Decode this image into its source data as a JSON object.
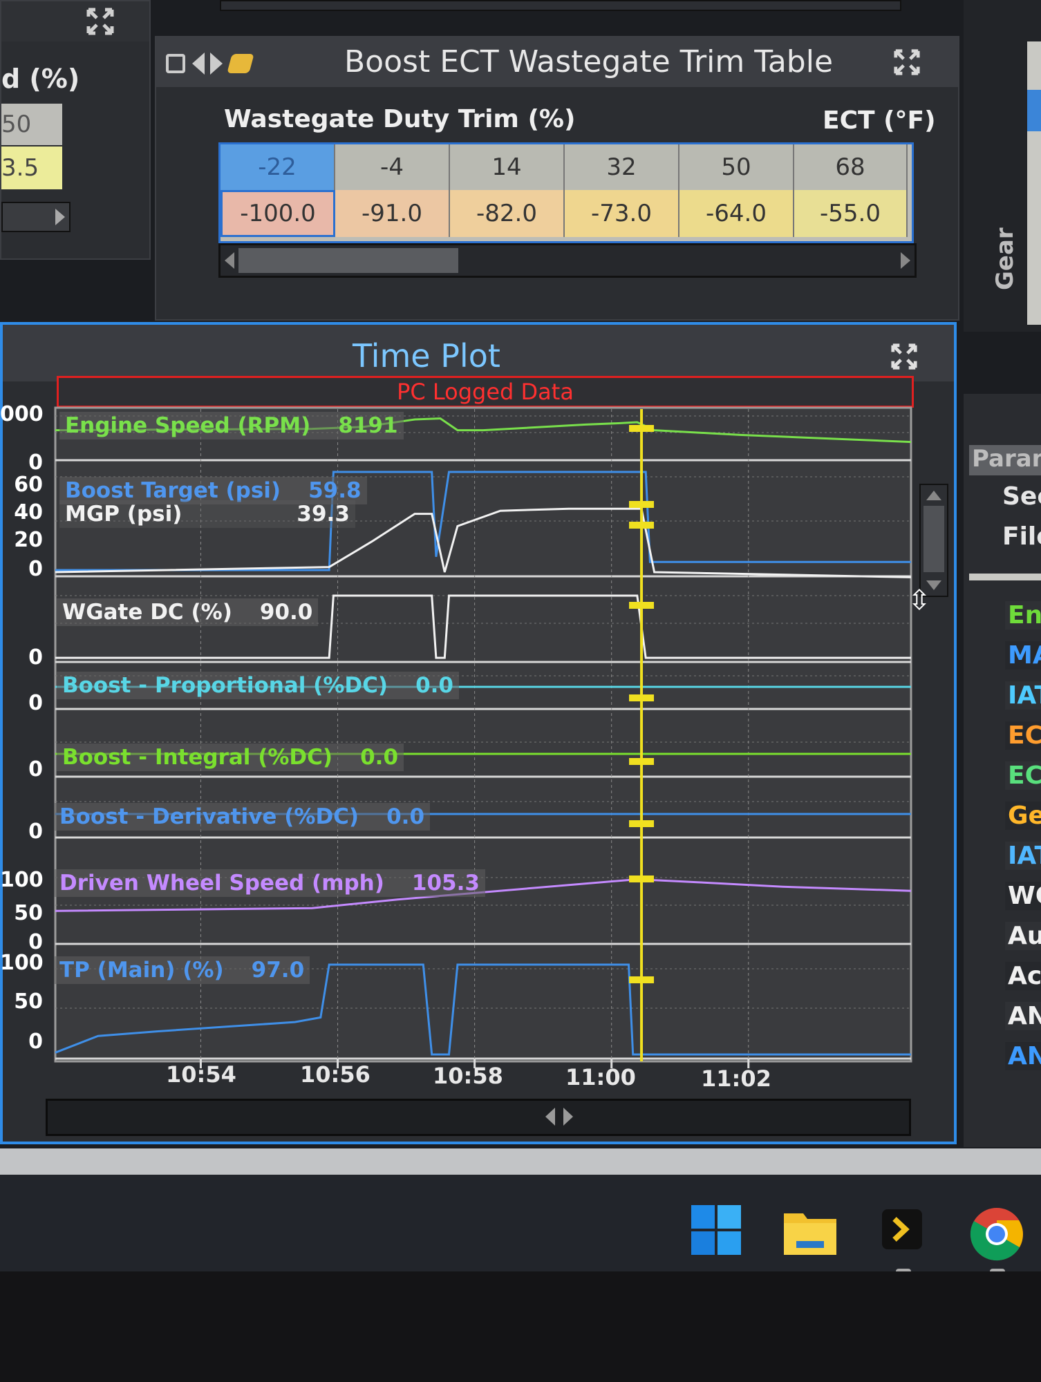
{
  "left_panel": {
    "title_partial": "d (%)",
    "values": [
      "50",
      "3.5"
    ]
  },
  "trim_table": {
    "title": "Boost ECT Wastegate Trim Table",
    "row_label": "Wastegate Duty Trim (%)",
    "col_label": "ECT (°F)",
    "ect_values": [
      "-22",
      "-4",
      "14",
      "32",
      "50",
      "68"
    ],
    "trim_values": [
      "-100.0",
      "-91.0",
      "-82.0",
      "-73.0",
      "-64.0",
      "-55.0"
    ],
    "trim_colors": [
      "#e8b8a9",
      "#ecc7a3",
      "#efcf9c",
      "#efd68f",
      "#ecdb8c",
      "#e8df95"
    ]
  },
  "right_panel": {
    "gear_label": "Gear",
    "params_header": "Param",
    "sec_label": "Sec",
    "file_label": "File",
    "items": [
      {
        "label": "Eng",
        "color": "#6fdc3a"
      },
      {
        "label": "MA",
        "color": "#3d9bff"
      },
      {
        "label": "IAT",
        "color": "#4ecbff"
      },
      {
        "label": "ECT",
        "color": "#ff9d2e"
      },
      {
        "label": "ECT",
        "color": "#59e07d"
      },
      {
        "label": "Gea",
        "color": "#ffb72a"
      },
      {
        "label": "IAT",
        "color": "#50b7ff"
      },
      {
        "label": "WG",
        "color": "#f0f0f0"
      },
      {
        "label": "Aux",
        "color": "#f0f0f0"
      },
      {
        "label": "Act",
        "color": "#f0f0f0"
      },
      {
        "label": "AN",
        "color": "#f0f0f0"
      },
      {
        "label": "AN",
        "color": "#3d9bff"
      }
    ]
  },
  "time_plot": {
    "title": "Time Plot",
    "banner": "PC Logged Data",
    "channels": [
      {
        "name": "Engine Speed (RPM)",
        "value": "8191",
        "color": "#79e04b"
      },
      {
        "name": "Boost Target (psi)",
        "value": "59.8",
        "color": "#3f8fe8"
      },
      {
        "name": "MGP (psi)",
        "value": "39.3",
        "color": "#f2f2f2"
      },
      {
        "name": "WGate DC (%)",
        "value": "90.0",
        "color": "#f2f2f2"
      },
      {
        "name": "Boost - Proportional (%DC)",
        "value": "0.0",
        "color": "#58d6e6"
      },
      {
        "name": "Boost - Integral (%DC)",
        "value": "0.0",
        "color": "#7ae02e"
      },
      {
        "name": "Boost - Derivative (%DC)",
        "value": "0.0",
        "color": "#3f8fe8"
      },
      {
        "name": "Driven Wheel Speed (mph)",
        "value": "105.3",
        "color": "#c48aff"
      },
      {
        "name": "TP (Main) (%)",
        "value": "97.0",
        "color": "#3f8fe8"
      }
    ],
    "y_ticks": [
      "000",
      "0",
      "60",
      "40",
      "20",
      "0",
      "0",
      "0",
      "0",
      "0",
      "100",
      "50",
      "0",
      "100",
      "50",
      "0"
    ],
    "x_ticks": [
      "10:54",
      "10:56",
      "10:58",
      "11:00",
      "11:02"
    ]
  },
  "chart_data": {
    "type": "line",
    "x_axis": "time",
    "x_tick_labels": [
      "10:54",
      "10:56",
      "10:58",
      "11:00",
      "11:02"
    ],
    "cursor_time": "11:00",
    "series": [
      {
        "name": "Engine Speed (RPM)",
        "points": [
          [
            0,
            0.55
          ],
          [
            0.3,
            0.58
          ],
          [
            0.36,
            0.62
          ],
          [
            0.42,
            0.78
          ],
          [
            0.45,
            0.8
          ],
          [
            0.47,
            0.55
          ],
          [
            0.5,
            0.55
          ],
          [
            0.62,
            0.67
          ],
          [
            0.66,
            0.7
          ],
          [
            0.68,
            0.72
          ],
          [
            0.7,
            0.55
          ],
          [
            0.8,
            0.45
          ],
          [
            1,
            0.3
          ]
        ]
      },
      {
        "name": "Boost Target (psi)",
        "points": [
          [
            0,
            0.02
          ],
          [
            0.32,
            0.02
          ],
          [
            0.325,
            0.98
          ],
          [
            0.44,
            0.98
          ],
          [
            0.445,
            0.15
          ],
          [
            0.46,
            0.98
          ],
          [
            0.69,
            0.98
          ],
          [
            0.695,
            0.1
          ],
          [
            1,
            0.1
          ]
        ]
      },
      {
        "name": "MGP (psi)",
        "points": [
          [
            0,
            0.0
          ],
          [
            0.32,
            0.05
          ],
          [
            0.37,
            0.3
          ],
          [
            0.42,
            0.57
          ],
          [
            0.44,
            0.57
          ],
          [
            0.455,
            0.0
          ],
          [
            0.47,
            0.45
          ],
          [
            0.52,
            0.6
          ],
          [
            0.6,
            0.62
          ],
          [
            0.685,
            0.62
          ],
          [
            0.7,
            0.0
          ],
          [
            1,
            -0.05
          ]
        ]
      },
      {
        "name": "WGate DC (%)",
        "points": [
          [
            0,
            0
          ],
          [
            0.32,
            0
          ],
          [
            0.325,
            0.9
          ],
          [
            0.44,
            0.9
          ],
          [
            0.445,
            0
          ],
          [
            0.455,
            0
          ],
          [
            0.46,
            0.9
          ],
          [
            0.68,
            0.9
          ],
          [
            0.69,
            0
          ],
          [
            1,
            0
          ]
        ]
      },
      {
        "name": "Boost - Proportional (%DC)",
        "points": [
          [
            0,
            0.0
          ],
          [
            1,
            0.0
          ]
        ]
      },
      {
        "name": "Boost - Integral (%DC)",
        "points": [
          [
            0,
            0.0
          ],
          [
            1,
            0.0
          ]
        ]
      },
      {
        "name": "Boost - Derivative (%DC)",
        "points": [
          [
            0,
            0.0
          ],
          [
            1,
            0.0
          ]
        ]
      },
      {
        "name": "Driven Wheel Speed (mph)",
        "points": [
          [
            0,
            50
          ],
          [
            0.3,
            55
          ],
          [
            0.4,
            70
          ],
          [
            0.6,
            95
          ],
          [
            0.68,
            105
          ],
          [
            0.75,
            100
          ],
          [
            0.85,
            92
          ],
          [
            1,
            85
          ]
        ]
      },
      {
        "name": "TP (Main) (%)",
        "points": [
          [
            0,
            2
          ],
          [
            0.05,
            20
          ],
          [
            0.12,
            25
          ],
          [
            0.2,
            30
          ],
          [
            0.28,
            35
          ],
          [
            0.31,
            40
          ],
          [
            0.32,
            97
          ],
          [
            0.43,
            97
          ],
          [
            0.44,
            0
          ],
          [
            0.46,
            0
          ],
          [
            0.47,
            97
          ],
          [
            0.67,
            97
          ],
          [
            0.675,
            0
          ],
          [
            1,
            0
          ]
        ]
      }
    ]
  },
  "taskbar": {
    "icons": [
      "windows-start-icon",
      "file-explorer-icon",
      "terminal-icon",
      "chrome-icon"
    ]
  }
}
